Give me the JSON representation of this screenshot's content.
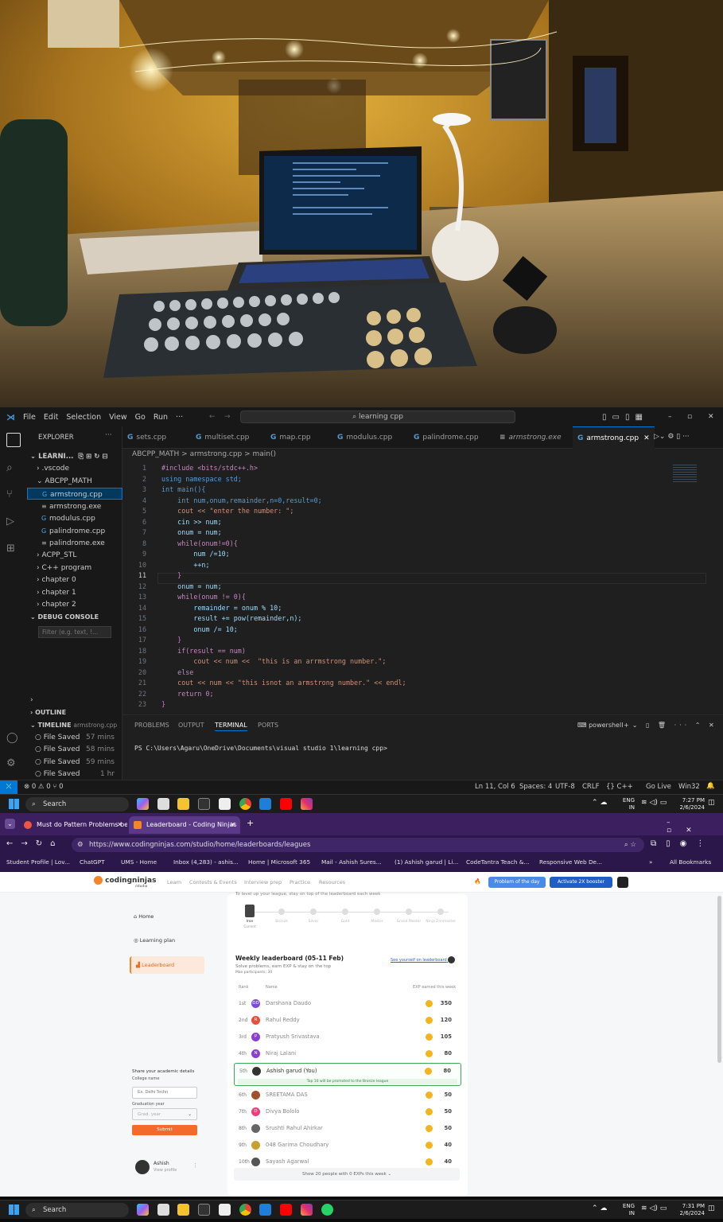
{
  "vscode": {
    "menu": [
      "File",
      "Edit",
      "Selection",
      "View",
      "Go",
      "Run",
      "···"
    ],
    "search": "learning cpp",
    "explorer_title": "EXPLORER",
    "tree": [
      {
        "label": "LEARNI...",
        "kind": "root"
      },
      {
        "label": ".vscode",
        "kind": "folder"
      },
      {
        "label": "ABCPP_MATH",
        "kind": "folder-open"
      },
      {
        "label": "armstrong.cpp",
        "kind": "cpp",
        "selected": true
      },
      {
        "label": "armstrong.exe",
        "kind": "exe"
      },
      {
        "label": "modulus.cpp",
        "kind": "cpp"
      },
      {
        "label": "palindrome.cpp",
        "kind": "cpp"
      },
      {
        "label": "palindrome.exe",
        "kind": "exe"
      },
      {
        "label": "ACPP_STL",
        "kind": "folder"
      },
      {
        "label": "C++ program",
        "kind": "folder"
      },
      {
        "label": "chapter 0",
        "kind": "folder"
      },
      {
        "label": "chapter 1",
        "kind": "folder"
      },
      {
        "label": "chapter 2",
        "kind": "folder"
      }
    ],
    "debug_console": "DEBUG CONSOLE",
    "filter_placeholder": "Filter (e.g. text, !...",
    "outline": "OUTLINE",
    "timeline": "TIMELINE",
    "timeline_file": "armstrong.cpp",
    "timeline_items": [
      {
        "label": "File Saved",
        "time": "57 mins"
      },
      {
        "label": "File Saved",
        "time": "58 mins"
      },
      {
        "label": "File Saved",
        "time": "59 mins"
      },
      {
        "label": "File Saved",
        "time": "1 hr"
      },
      {
        "label": "File Saved",
        "time": ""
      }
    ],
    "tabs": [
      "sets.cpp",
      "multiset.cpp",
      "map.cpp",
      "modulus.cpp",
      "palindrome.cpp",
      "armstrong.exe",
      "armstrong.cpp"
    ],
    "breadcrumb": "ABCPP_MATH  >  armstrong.cpp  >  main()",
    "code": [
      "#include <bits/stdc++.h>",
      "using namespace std;",
      "int main(){",
      "    int num,onum,remainder,n=0,result=0;",
      "    cout << \"enter the number: \";",
      "    cin >> num;",
      "    onum = num;",
      "    while(onum!=0){",
      "        num /=10;",
      "        ++n;",
      "    }",
      "    onum = num;",
      "    while(onum != 0){",
      "        remainder = onum % 10;",
      "        result += pow(remainder,n);",
      "        onum /= 10;",
      "    }",
      "    if(result == num)",
      "        cout << num <<  \"this is an arrmstrong number.\";",
      "    else",
      "    cout << num << \"this isnot an armstrong number.\" << endl;",
      "    return 0;",
      "}"
    ],
    "panel_tabs": [
      "PROBLEMS",
      "OUTPUT",
      "TERMINAL",
      "PORTS"
    ],
    "terminal_shell": "powershell",
    "terminal_line": "PS C:\\Users\\Agaru\\OneDrive\\Documents\\visual studio 1\\learning cpp>",
    "status_left": "⊗ 0 ⚠ 0   ⑂ 0",
    "status_right": [
      "Ln 11, Col 6",
      "Spaces: 4",
      "UTF-8",
      "CRLF",
      "{} C++",
      "Go Live",
      "Win32"
    ]
  },
  "taskbar1": {
    "search": "Search",
    "lang": "ENG",
    "region": "IN",
    "time": "7:27 PM",
    "date": "2/6/2024"
  },
  "taskbar2": {
    "search": "Search",
    "lang": "ENG",
    "region": "IN",
    "time": "7:31 PM",
    "date": "2/6/2024"
  },
  "browser": {
    "tabs": [
      "Must do Pattern Problems befo",
      "Leaderboard - Coding Ninjas"
    ],
    "url": "https://www.codingninjas.com/studio/home/leaderboards/leagues",
    "bookmarks": [
      "Student Profile | Lov...",
      "ChatGPT",
      "UMS - Home",
      "Inbox (4,283) - ashis...",
      "Home | Microsoft 365",
      "Mail - Ashish Sures...",
      "(1) Ashish garud | Li...",
      "CodeTantra Teach &...",
      "Responsive Web De...",
      "All Bookmarks"
    ],
    "site_logo": "codingninjas",
    "site_sub": "/studio",
    "nav": [
      "Learn",
      "Contests & Events",
      "Interview prep",
      "Practice",
      "Resources"
    ],
    "problem_btn": "Problem of the day",
    "booster_btn": "Activate 2X booster",
    "league_hint": "To level up your league, stay on top of the leaderboard each week",
    "leagues": [
      "Iron",
      "Bronze",
      "Silver",
      "Gold",
      "Master",
      "Grand Master",
      "Ninja Zenmaster"
    ],
    "league_current": "Current",
    "sidebar": [
      "Home",
      "Learning plan",
      "Leaderboard"
    ],
    "academic_title": "Share your academic details",
    "college_label": "College name",
    "college_ph": "Ex. Delhi Techn",
    "grad_label": "Graduation year",
    "grad_ph": "Grad. year",
    "submit": "Submit",
    "user": "Ashish",
    "user_link": "View profile",
    "lb_title": "Weekly leaderboard (05-11 Feb)",
    "lb_sub": "Solve problems, earn EXP & stay on the top",
    "lb_participants": "Max participants: 30",
    "lb_see": "See yourself on leaderboard",
    "col_rank": "Rank",
    "col_name": "Name",
    "col_exp": "EXP earned this week",
    "rows": [
      {
        "rank": "1st",
        "name": "Darshana Daudo",
        "exp": "350",
        "color": "#7b4bd6",
        "ini": "DD"
      },
      {
        "rank": "2nd",
        "name": "Rahul Reddy",
        "exp": "120",
        "color": "#e8503a",
        "ini": "R"
      },
      {
        "rank": "3rd",
        "name": "Pratyush Srivastava",
        "exp": "105",
        "color": "#8a3fd1",
        "ini": "P"
      },
      {
        "rank": "4th",
        "name": "Niraj Lalani",
        "exp": "80",
        "color": "#8a3fd1",
        "ini": "N"
      },
      {
        "rank": "5th",
        "name": "Ashish garud (You)",
        "exp": "80",
        "color": "#333",
        "ini": ""
      },
      {
        "rank": "6th",
        "name": "SREETAMA DAS",
        "exp": "50",
        "color": "#a0522d",
        "ini": ""
      },
      {
        "rank": "7th",
        "name": "Divya Bololo",
        "exp": "50",
        "color": "#e8407a",
        "ini": "D"
      },
      {
        "rank": "8th",
        "name": "Srushti Rahul Ahirkar",
        "exp": "50",
        "color": "#666",
        "ini": ""
      },
      {
        "rank": "9th",
        "name": "048 Garima Choudhary",
        "exp": "40",
        "color": "#c8a030",
        "ini": ""
      },
      {
        "rank": "10th",
        "name": "Sayash Agarwal",
        "exp": "40",
        "color": "#555",
        "ini": ""
      }
    ],
    "promote_note": "Top 10 will be promoted to the Bronze league",
    "show_more": "Show 20 people with 0 EXPs this week  ⌄"
  }
}
